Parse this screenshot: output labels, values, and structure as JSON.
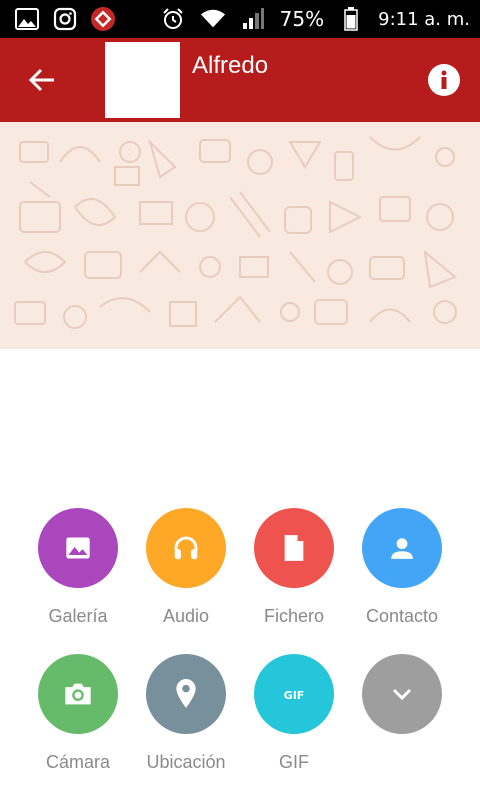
{
  "status_bar": {
    "battery": "75%",
    "time": "9:11 a. m.",
    "icons": [
      "gallery-icon",
      "instagram-icon",
      "app-icon",
      "alarm-icon",
      "wifi-icon",
      "signal-icon",
      "battery-icon"
    ]
  },
  "app_bar": {
    "contact_name": "Alfredo",
    "background_color": "#b71c1c"
  },
  "attachments": [
    {
      "label": "Galería",
      "icon": "image-icon",
      "color": "#ab47bc"
    },
    {
      "label": "Audio",
      "icon": "headphones-icon",
      "color": "#ffa726"
    },
    {
      "label": "Fichero",
      "icon": "file-icon",
      "color": "#ef5350"
    },
    {
      "label": "Contacto",
      "icon": "person-icon",
      "color": "#42a5f5"
    },
    {
      "label": "Cámara",
      "icon": "camera-icon",
      "color": "#66bb6a"
    },
    {
      "label": "Ubicación",
      "icon": "location-icon",
      "color": "#78909c"
    },
    {
      "label": "GIF",
      "icon": "gif-icon",
      "color": "#26c6da"
    },
    {
      "label": "",
      "icon": "chevron-down-icon",
      "color": "#9e9e9e"
    }
  ]
}
